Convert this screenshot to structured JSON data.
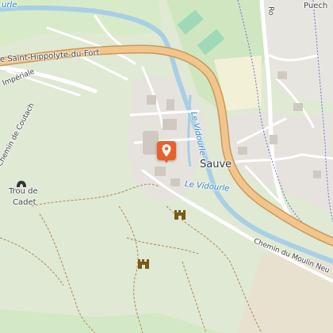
{
  "map": {
    "colors": {
      "forest": "#dfe9d3",
      "water": "#a8cfe6",
      "major_road": "#f2c58c",
      "residential": "#e6e3de",
      "marker": "#e8612c"
    },
    "labels": {
      "river_top": "urle",
      "road_main": "e Saint-Hippolyte-du-Fort",
      "road_imperiale": "Impériale",
      "chemin_coutach": "Chemin de Coutach",
      "river_vidourle_vertical": "Le Vidourle",
      "town": "Sauve",
      "river_vidourle": "Le Vidourle",
      "poi_trou": "Trou de",
      "poi_cadet": "Cadet",
      "chemin_moulin": "Chemin du Moulin Neu",
      "puech": "Puech",
      "ro": "Ro"
    },
    "icons": {
      "marker": "map-pin-icon",
      "cave": "cave-icon",
      "castle": "castle-icon"
    }
  }
}
